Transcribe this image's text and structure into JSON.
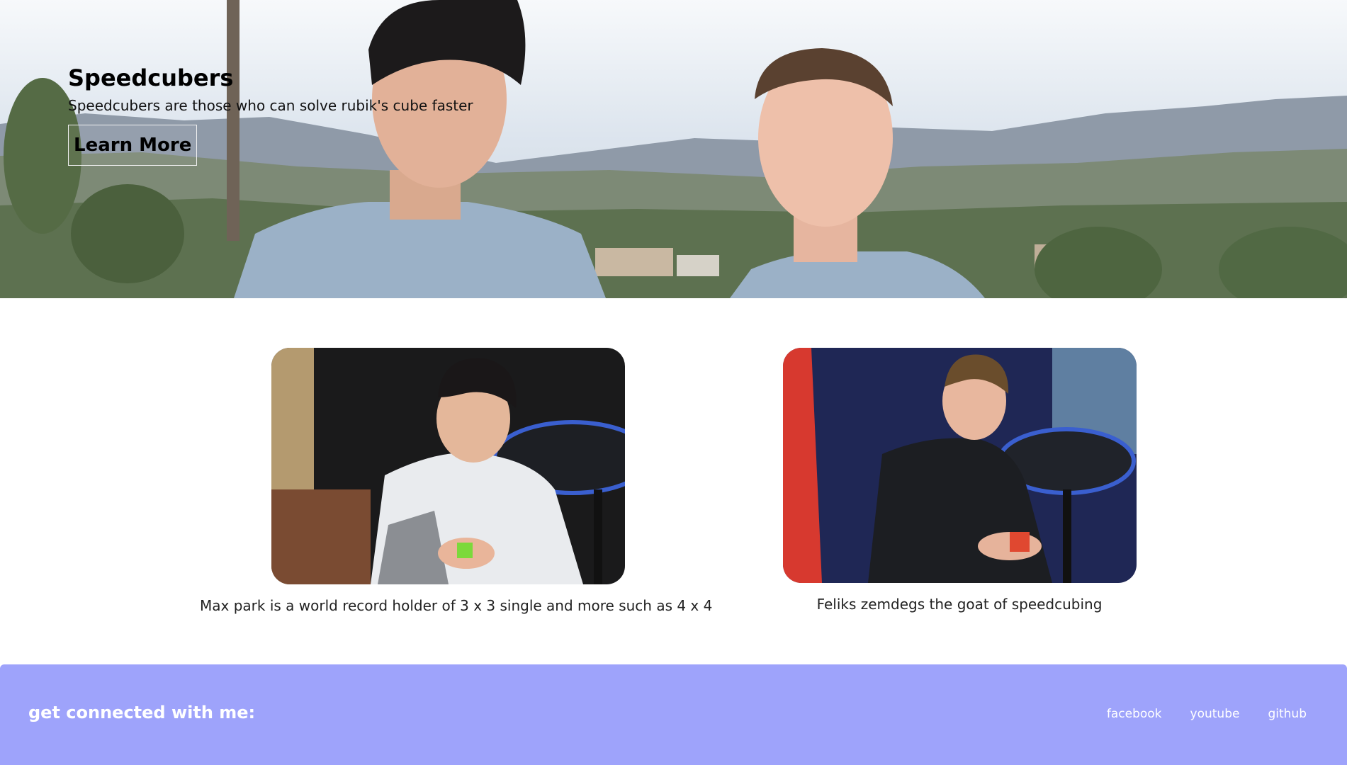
{
  "hero": {
    "title": "Speedcubers",
    "subtitle": "Speedcubers are those who can solve rubik's cube faster",
    "button_label": "Learn More"
  },
  "cards": [
    {
      "caption": "Max park is a world record holder of 3 x 3 single and more such as 4 x 4"
    },
    {
      "caption": "Feliks zemdegs the goat of speedcubing"
    }
  ],
  "footer": {
    "title": "get connected with me:",
    "links": [
      "facebook",
      "youtube",
      "github"
    ]
  },
  "colors": {
    "footer_bg": "#9ea3fb",
    "footer_text": "#ffffff"
  }
}
